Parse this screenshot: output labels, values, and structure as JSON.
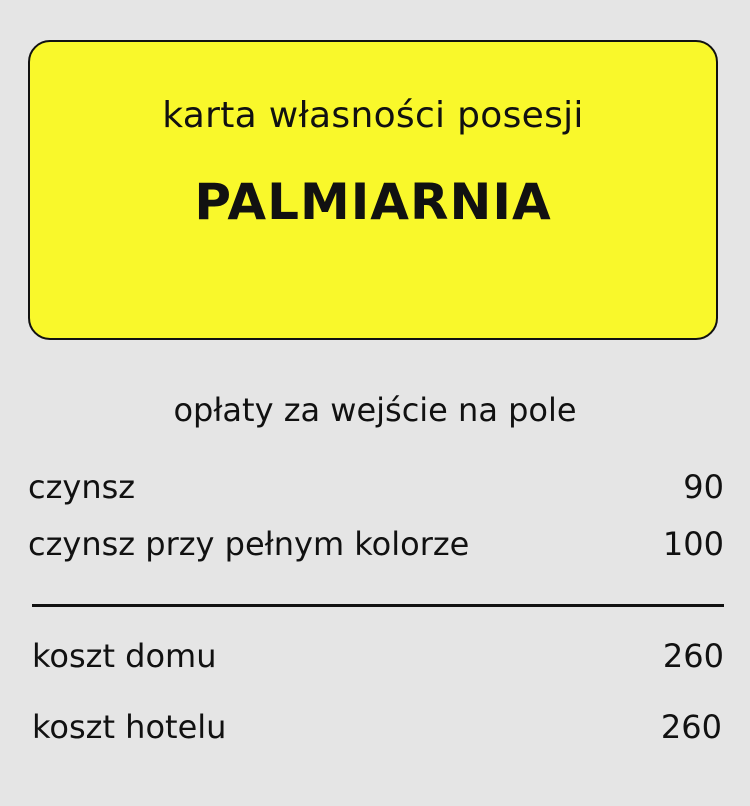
{
  "card": {
    "subtitle": "karta własności posesji",
    "name": "PALMIARNIA",
    "background_color": "#f9f82b"
  },
  "fees": {
    "heading": "opłaty za wejście na pole",
    "rent": {
      "label": "czynsz",
      "value": "90"
    },
    "rent_full_color": {
      "label": "czynsz przy pełnym kolorze",
      "value": "100"
    }
  },
  "costs": {
    "house": {
      "label": "koszt domu",
      "value": "260"
    },
    "hotel": {
      "label": "koszt hotelu",
      "value": "260"
    }
  }
}
